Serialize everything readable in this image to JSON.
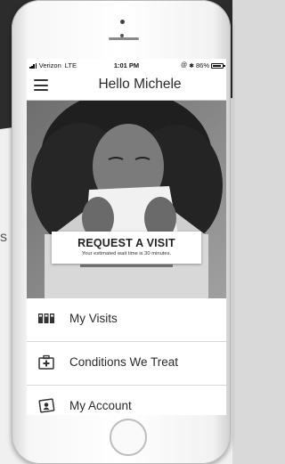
{
  "status_bar": {
    "carrier": "Verizon",
    "network": "LTE",
    "time": "1:01 PM",
    "battery_text": "86%",
    "battery_level": 0.86
  },
  "header": {
    "title": "Hello Michele",
    "menu_icon": "hamburger-menu-icon"
  },
  "hero": {
    "request_title": "REQUEST A VISIT",
    "wait_text": "Your estimated wait time is 30 minutes."
  },
  "menu": {
    "items": [
      {
        "label": "My Visits",
        "icon": "visits-icon"
      },
      {
        "label": "Conditions We Treat",
        "icon": "first-aid-kit-icon"
      },
      {
        "label": "My Account",
        "icon": "account-card-icon"
      }
    ]
  },
  "background": {
    "side_glyph": "s"
  },
  "colors": {
    "screen_bg": "#ffffff",
    "text_dark": "#2b2b2b",
    "divider": "#d6d6d6"
  }
}
